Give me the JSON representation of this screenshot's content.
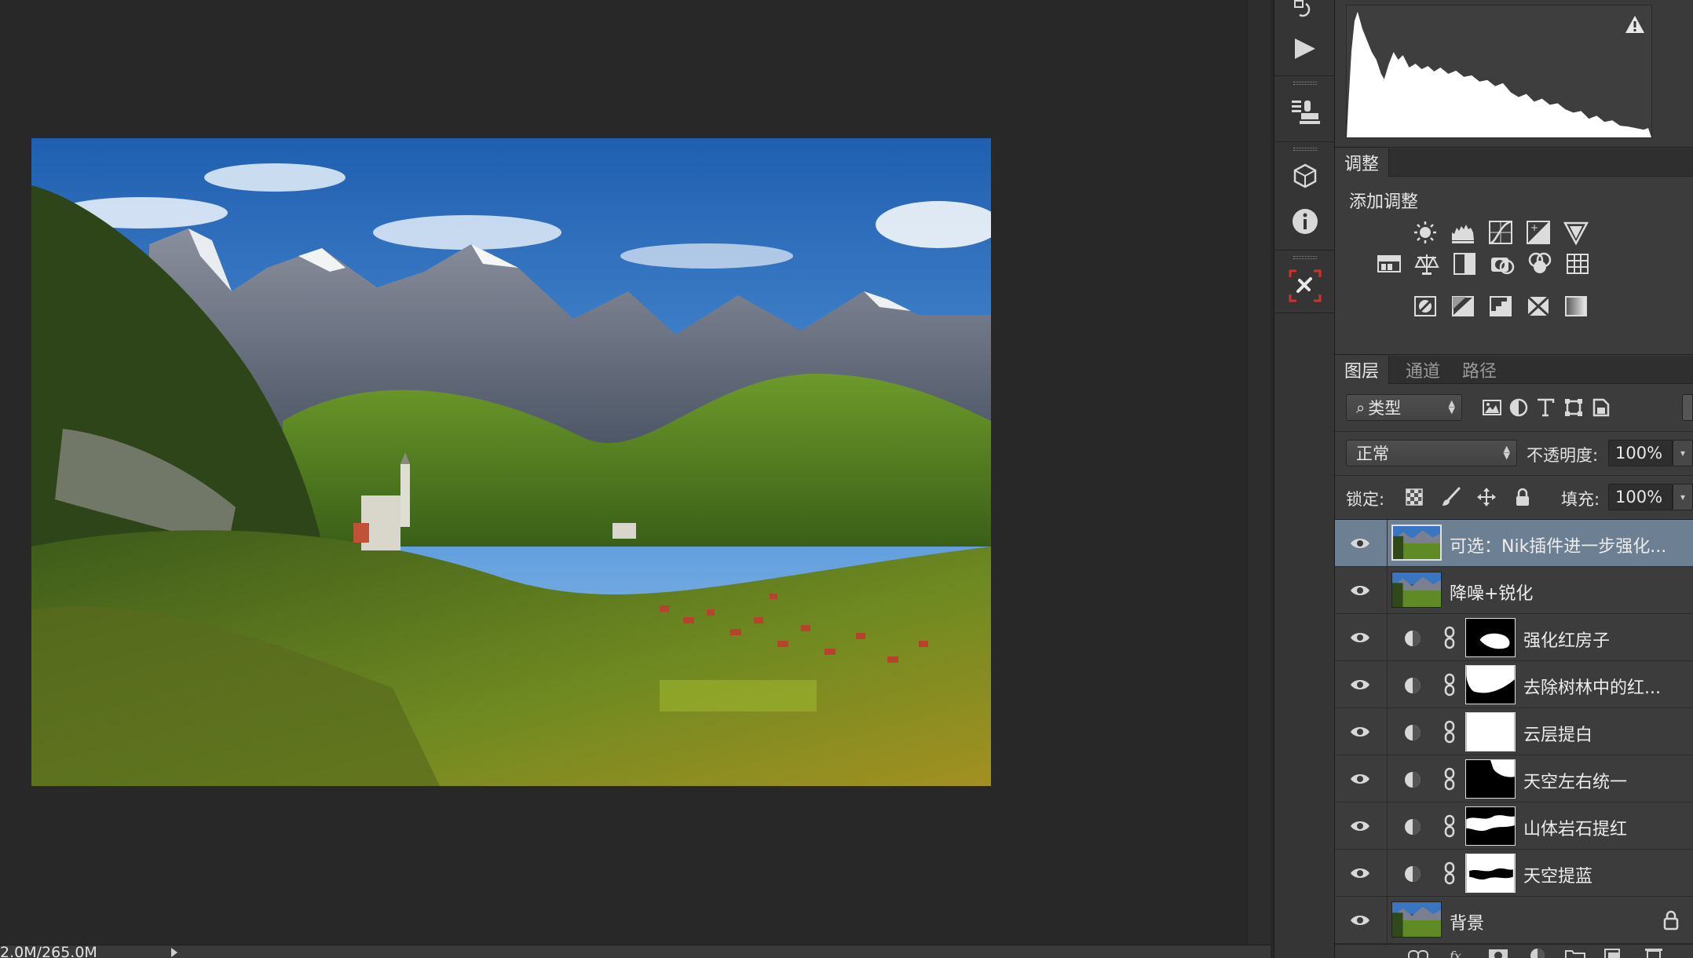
{
  "status_bar": {
    "doc_size": "2.0M/265.0M"
  },
  "toolstrip": {
    "items": [
      "history-icon",
      "play-actions-icon",
      "clone-source-icon",
      "3d-icon",
      "info-icon",
      "tool-presets-icon"
    ]
  },
  "histogram": {
    "warning": "cached-data-warning-icon"
  },
  "adjustments": {
    "tab_label": "调整",
    "add_label": "添加调整",
    "row1": [
      "brightness-contrast-icon",
      "levels-icon",
      "curves-icon",
      "exposure-icon",
      "vibrance-icon"
    ],
    "row2": [
      "hue-saturation-icon",
      "color-balance-icon",
      "black-white-icon",
      "photo-filter-icon",
      "channel-mixer-icon",
      "color-lookup-icon"
    ],
    "row3": [
      "invert-icon",
      "posterize-icon",
      "threshold-icon",
      "selective-color-icon",
      "gradient-map-icon"
    ]
  },
  "layers_panel": {
    "tabs": [
      "图层",
      "通道",
      "路径"
    ],
    "filter_label": "类型",
    "blend_mode": "正常",
    "opacity_label": "不透明度:",
    "opacity_value": "100%",
    "lock_label": "锁定:",
    "fill_label": "填充:",
    "fill_value": "100%",
    "layers": [
      {
        "name": "可选：Nik插件进一步强化...",
        "kind": "pixel",
        "selected": true
      },
      {
        "name": "降噪+锐化",
        "kind": "pixel",
        "selected": false
      },
      {
        "name": "强化红房子",
        "kind": "adjustment",
        "mask": "blob-right"
      },
      {
        "name": "去除树林中的红...",
        "kind": "adjustment",
        "mask": "blob-top"
      },
      {
        "name": "云层提白",
        "kind": "adjustment",
        "mask": "white"
      },
      {
        "name": "天空左右统一",
        "kind": "adjustment",
        "mask": "corner"
      },
      {
        "name": "山体岩石提红",
        "kind": "adjustment",
        "mask": "band"
      },
      {
        "name": "天空提蓝",
        "kind": "adjustment",
        "mask": "white-band"
      },
      {
        "name": "背景",
        "kind": "background",
        "locked": true
      }
    ]
  },
  "colors": {
    "selection": "#6d7f93",
    "panel": "#3c3c3c",
    "canvas": "#282828",
    "accent_red": "#d0312d"
  }
}
